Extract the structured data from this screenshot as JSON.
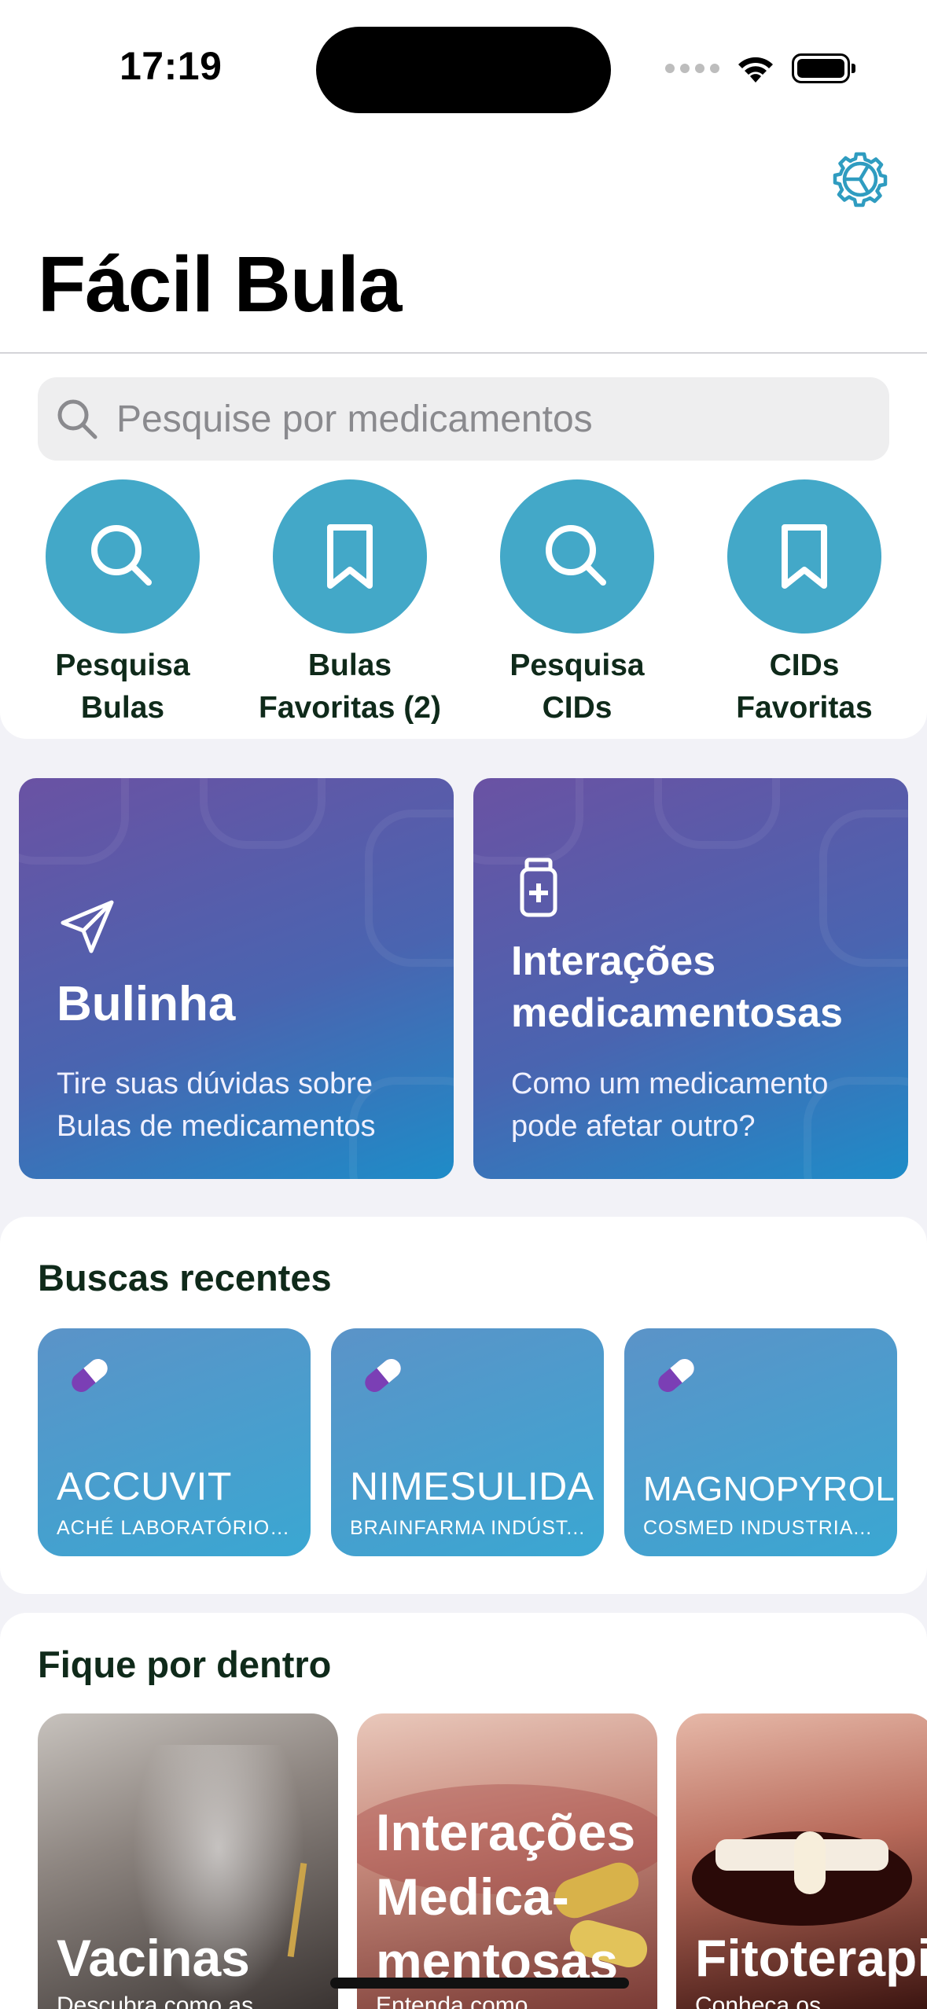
{
  "status_bar": {
    "time": "17:19"
  },
  "header": {
    "title": "Fácil Bula"
  },
  "search": {
    "placeholder": "Pesquise por medicamentos"
  },
  "quick_actions": [
    {
      "line1": "Pesquisa",
      "line2": "Bulas",
      "icon": "search-icon"
    },
    {
      "line1": "Bulas",
      "line2": "Favoritas (2)",
      "icon": "bookmark-icon"
    },
    {
      "line1": "Pesquisa",
      "line2": "CIDs",
      "icon": "search-icon"
    },
    {
      "line1": "CIDs",
      "line2": "Favoritas",
      "icon": "bookmark-icon"
    }
  ],
  "features": {
    "bulinha": {
      "title": "Bulinha",
      "subtitle_1": "Tire suas dúvidas sobre",
      "subtitle_2": "Bulas de medicamentos",
      "icon": "paper-plane-icon"
    },
    "interacoes": {
      "title_1": "Interações",
      "title_2": "medicamentosas",
      "subtitle_1": "Como um medicamento",
      "subtitle_2": "pode afetar outro?",
      "icon": "medicine-bottle-icon"
    }
  },
  "recent": {
    "title": "Buscas recentes",
    "items": [
      {
        "name": "ACCUVIT",
        "lab": "ACHÉ LABORATÓRIOS..."
      },
      {
        "name": "NIMESULIDA",
        "lab": "BRAINFARMA INDÚST..."
      },
      {
        "name": "MAGNOPYROL",
        "lab": "COSMED INDUSTRIA..."
      }
    ]
  },
  "news": {
    "title": "Fique por dentro",
    "items": [
      {
        "title": "Vacinas",
        "subtitle": "Descubra como as"
      },
      {
        "title_1": "Interações",
        "title_2": "Medica-",
        "title_3": "mentosas",
        "subtitle": "Entenda como"
      },
      {
        "title": "Fitoterapi",
        "subtitle": "Conheça os benefícios"
      }
    ]
  },
  "colors": {
    "accent": "#43a8c8",
    "feature_gradient_start": "#6a52a3",
    "feature_gradient_end": "#1e8cc8",
    "recent_card": "#3aa7d2",
    "pill_purple": "#7b3fb5"
  }
}
